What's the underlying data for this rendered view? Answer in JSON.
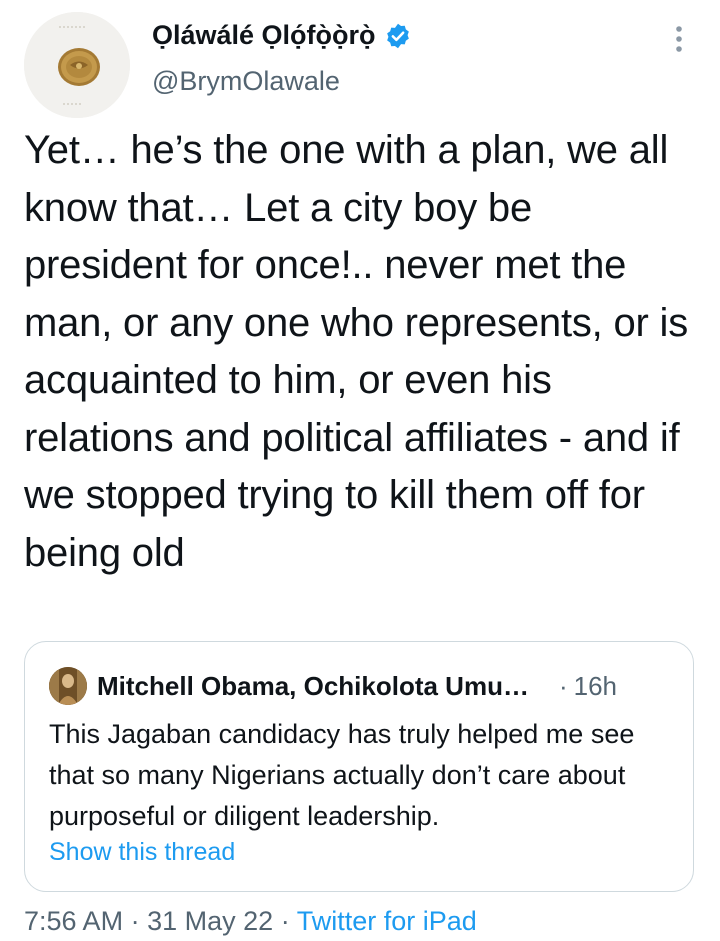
{
  "tweet": {
    "author": {
      "name": "Ọláwálé Ọlọ́fọ̀ọ̀rọ̀",
      "handle": "@BrymOlawale",
      "verified": true
    },
    "text": "Yet… he’s the one with a plan, we all know that… Let a city boy be president for once!.. never met the man, or any one who represents, or is acquainted to him, or even his relations and political affiliates - and if we stopped trying to kill them off for being old",
    "time": "7:56 AM",
    "date": "31 May 22",
    "source": "Twitter for iPad",
    "separator": "·"
  },
  "quoted": {
    "author_name": "Mitchell Obama, Ochikolota Umu…",
    "separator": "·",
    "time_ago": "16h",
    "text": "This Jagaban candidacy has truly helped me see that so many Nigerians actually don’t care about purposeful or diligent leadership.",
    "thread_link": "Show this thread"
  },
  "icons": {
    "more": "more-vertical-icon",
    "verified": "verified-badge-icon"
  },
  "colors": {
    "text": "#0f1419",
    "secondary": "#536471",
    "link": "#1d9bf0",
    "border": "#cfd9de",
    "verified": "#1d9bf0"
  }
}
